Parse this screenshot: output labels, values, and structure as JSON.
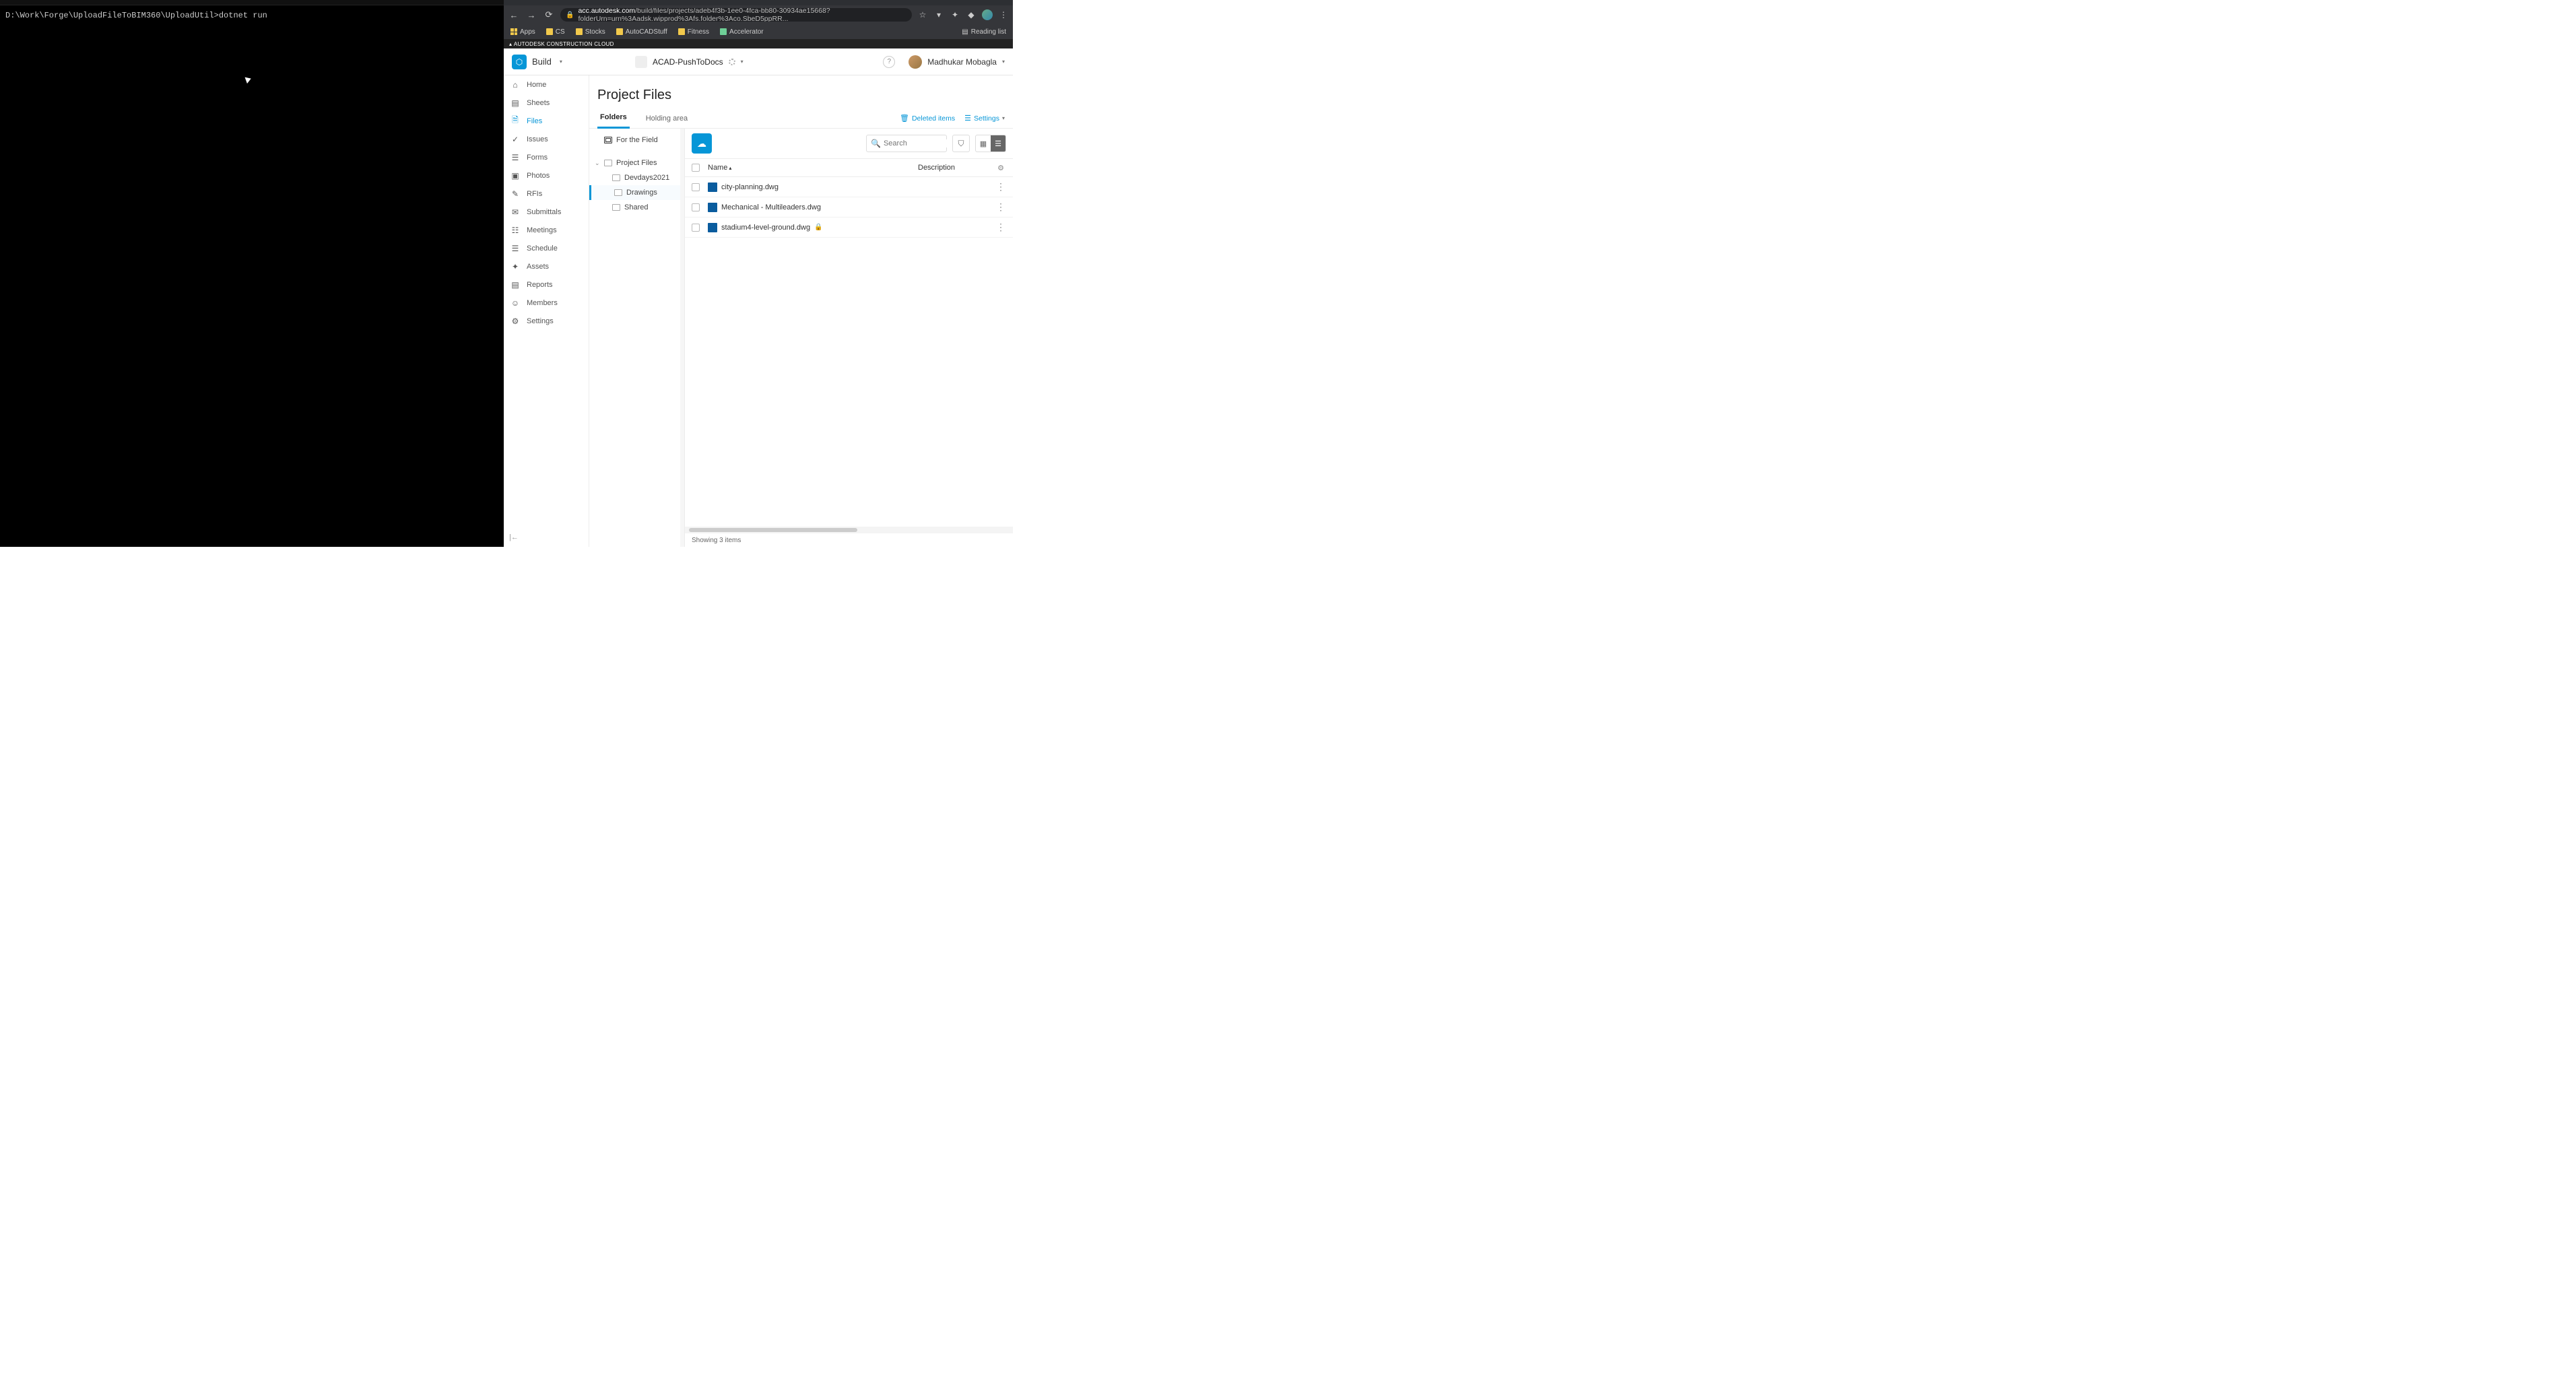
{
  "terminal": {
    "prompt": "D:\\Work\\Forge\\UploadFileToBIM360\\UploadUtil>dotnet run"
  },
  "browser": {
    "url_display": "acc.autodesk.com/build/files/projects/adeb4f3b-1ee0-4fca-bb80-30934ae15668?folderUrn=urn%3Aadsk.wipprod%3Afs.folder%3Aco.SbeD5ppRR...",
    "url_domain": "acc.autodesk.com",
    "bookmarks": [
      {
        "label": "Apps"
      },
      {
        "label": "CS"
      },
      {
        "label": "Stocks"
      },
      {
        "label": "AutoCADStuff"
      },
      {
        "label": "Fitness"
      },
      {
        "label": "Accelerator"
      }
    ],
    "reading_list": "Reading list"
  },
  "acc_brand": "AUTODESK CONSTRUCTION CLOUD",
  "header": {
    "product": "Build",
    "project": "ACAD-PushToDocs",
    "user": "Madhukar Mobagla"
  },
  "leftnav": [
    {
      "label": "Home",
      "icon": "⌂"
    },
    {
      "label": "Sheets",
      "icon": "▤"
    },
    {
      "label": "Files",
      "icon": "🗎",
      "active": true
    },
    {
      "label": "Issues",
      "icon": "✓"
    },
    {
      "label": "Forms",
      "icon": "☰"
    },
    {
      "label": "Photos",
      "icon": "▣"
    },
    {
      "label": "RFIs",
      "icon": "✎"
    },
    {
      "label": "Submittals",
      "icon": "✉"
    },
    {
      "label": "Meetings",
      "icon": "☷"
    },
    {
      "label": "Schedule",
      "icon": "☰"
    },
    {
      "label": "Assets",
      "icon": "✦"
    },
    {
      "label": "Reports",
      "icon": "▤"
    },
    {
      "label": "Members",
      "icon": "☺"
    },
    {
      "label": "Settings",
      "icon": "⚙"
    }
  ],
  "page": {
    "title": "Project Files",
    "tabs": {
      "folders": "Folders",
      "holding": "Holding area"
    },
    "deleted": "Deleted items",
    "settings": "Settings"
  },
  "tree": {
    "for_field": "For the Field",
    "root": "Project Files",
    "children": [
      "Devdays2021",
      "Drawings",
      "Shared"
    ]
  },
  "files": {
    "search_placeholder": "Search",
    "cols": {
      "name": "Name",
      "desc": "Description"
    },
    "rows": [
      {
        "name": "city-planning.dwg",
        "locked": false
      },
      {
        "name": "Mechanical - Multileaders.dwg",
        "locked": false
      },
      {
        "name": "stadium4-level-ground.dwg",
        "locked": true
      }
    ],
    "status": "Showing 3 items"
  }
}
